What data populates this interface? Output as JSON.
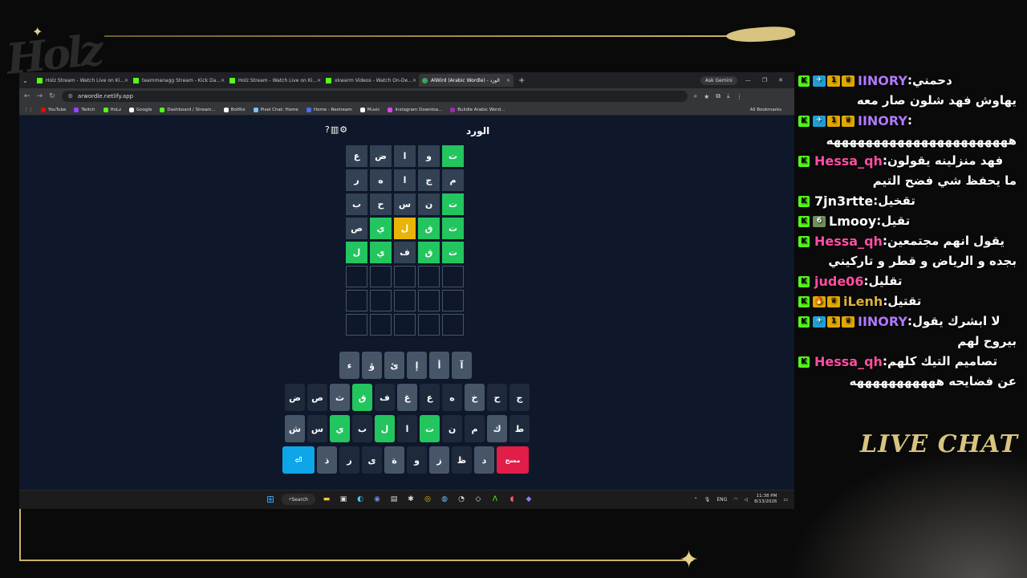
{
  "overlay": {
    "logo": "Holz",
    "live_chat_label": "LIVE CHAT"
  },
  "browser": {
    "tabs": [
      {
        "title": "Holz Stream - Watch Live on Ki..."
      },
      {
        "title": "teammanagg Stream - Kick Da..."
      },
      {
        "title": "Holz Stream - Watch Live on Ki..."
      },
      {
        "title": "xkwarm Videos - Watch On-De..."
      },
      {
        "title": "AlWird (Arabic Wordle) - الورد"
      }
    ],
    "ask_button": "Ask Gemini",
    "url": "arwordle.netlify.app",
    "bookmarks": [
      {
        "label": "YouTube",
        "color": "#ff0000"
      },
      {
        "label": "Twitch",
        "color": "#9146ff"
      },
      {
        "label": "HoLz",
        "color": "#53fc18"
      },
      {
        "label": "Google",
        "color": "#ffffff"
      },
      {
        "label": "Dashboard / Stream...",
        "color": "#53fc18"
      },
      {
        "label": "BotRix",
        "color": "#ffffff"
      },
      {
        "label": "Pixel Chat: Home",
        "color": "#7cc4ff"
      },
      {
        "label": "Home - Restream",
        "color": "#4b6bff"
      },
      {
        "label": "Music",
        "color": "#ffffff"
      },
      {
        "label": "Instagram Downloa...",
        "color": "#e040fb"
      },
      {
        "label": "Buildle Arabic Word...",
        "color": "#9c27b0"
      }
    ],
    "all_bookmarks": "All Bookmarks"
  },
  "game": {
    "title": "الورد",
    "icons": [
      "help-icon",
      "stats-icon",
      "settings-icon"
    ],
    "rows": [
      [
        {
          "l": "ت",
          "s": "correct"
        },
        {
          "l": "و",
          "s": "absent"
        },
        {
          "l": "ا",
          "s": "absent"
        },
        {
          "l": "ض",
          "s": "absent"
        },
        {
          "l": "ع",
          "s": "absent"
        }
      ],
      [
        {
          "l": "م",
          "s": "absent"
        },
        {
          "l": "ج",
          "s": "absent"
        },
        {
          "l": "ا",
          "s": "absent"
        },
        {
          "l": "ه",
          "s": "absent"
        },
        {
          "l": "ر",
          "s": "absent"
        }
      ],
      [
        {
          "l": "ت",
          "s": "correct"
        },
        {
          "l": "ن",
          "s": "absent"
        },
        {
          "l": "س",
          "s": "absent"
        },
        {
          "l": "ح",
          "s": "absent"
        },
        {
          "l": "ب",
          "s": "absent"
        }
      ],
      [
        {
          "l": "ت",
          "s": "correct"
        },
        {
          "l": "ق",
          "s": "correct"
        },
        {
          "l": "ل",
          "s": "present"
        },
        {
          "l": "ي",
          "s": "correct"
        },
        {
          "l": "ص",
          "s": "absent"
        }
      ],
      [
        {
          "l": "ت",
          "s": "correct"
        },
        {
          "l": "ق",
          "s": "correct"
        },
        {
          "l": "ف",
          "s": "absent"
        },
        {
          "l": "ي",
          "s": "correct"
        },
        {
          "l": "ل",
          "s": "correct"
        }
      ],
      [
        {
          "l": "",
          "s": "empty"
        },
        {
          "l": "",
          "s": "empty"
        },
        {
          "l": "",
          "s": "empty"
        },
        {
          "l": "",
          "s": "empty"
        },
        {
          "l": "",
          "s": "empty"
        }
      ],
      [
        {
          "l": "",
          "s": "empty"
        },
        {
          "l": "",
          "s": "empty"
        },
        {
          "l": "",
          "s": "empty"
        },
        {
          "l": "",
          "s": "empty"
        },
        {
          "l": "",
          "s": "empty"
        }
      ],
      [
        {
          "l": "",
          "s": "empty"
        },
        {
          "l": "",
          "s": "empty"
        },
        {
          "l": "",
          "s": "empty"
        },
        {
          "l": "",
          "s": "empty"
        },
        {
          "l": "",
          "s": "empty"
        }
      ]
    ],
    "keyboard": [
      [
        {
          "k": "آ",
          "s": "used"
        },
        {
          "k": "أ",
          "s": "used"
        },
        {
          "k": "إ",
          "s": "used"
        },
        {
          "k": "ئ",
          "s": "used"
        },
        {
          "k": "ؤ",
          "s": "used"
        },
        {
          "k": "ء",
          "s": "used"
        }
      ],
      [
        {
          "k": "ج",
          "s": "dark"
        },
        {
          "k": "ح",
          "s": "dark"
        },
        {
          "k": "خ",
          "s": "used"
        },
        {
          "k": "ه",
          "s": "dark"
        },
        {
          "k": "ع",
          "s": "dark"
        },
        {
          "k": "غ",
          "s": "used"
        },
        {
          "k": "ف",
          "s": "dark"
        },
        {
          "k": "ق",
          "s": "correct"
        },
        {
          "k": "ث",
          "s": "used"
        },
        {
          "k": "ص",
          "s": "dark"
        },
        {
          "k": "ض",
          "s": "dark"
        }
      ],
      [
        {
          "k": "ط",
          "s": "dark"
        },
        {
          "k": "ك",
          "s": "used"
        },
        {
          "k": "م",
          "s": "dark"
        },
        {
          "k": "ن",
          "s": "dark"
        },
        {
          "k": "ت",
          "s": "correct"
        },
        {
          "k": "ا",
          "s": "dark"
        },
        {
          "k": "ل",
          "s": "correct"
        },
        {
          "k": "ب",
          "s": "dark"
        },
        {
          "k": "ي",
          "s": "correct"
        },
        {
          "k": "س",
          "s": "dark"
        },
        {
          "k": "ش",
          "s": "used"
        }
      ],
      [
        {
          "k": "مسح",
          "s": "del"
        },
        {
          "k": "د",
          "s": "used"
        },
        {
          "k": "ظ",
          "s": "dark"
        },
        {
          "k": "ز",
          "s": "used"
        },
        {
          "k": "و",
          "s": "dark"
        },
        {
          "k": "ة",
          "s": "used"
        },
        {
          "k": "ى",
          "s": "dark"
        },
        {
          "k": "ر",
          "s": "dark"
        },
        {
          "k": "ذ",
          "s": "used"
        },
        {
          "k": "⏎",
          "s": "enter"
        }
      ]
    ]
  },
  "taskbar": {
    "search_label": "Search",
    "lang": "ENG",
    "time": "11:38 PM",
    "date": "8/13/2026"
  },
  "chat": [
    {
      "user": "IINORY",
      "color": "#b179ff",
      "badges": [
        "sub",
        "1",
        "crown"
      ],
      "text": "دحمني",
      "cont": "يهاوش فهد شلون صار معه"
    },
    {
      "user": "IINORY",
      "color": "#b179ff",
      "badges": [
        "sub",
        "1",
        "crown"
      ],
      "text": "",
      "cont": "هههههههههههههههههههههههه"
    },
    {
      "user": "Hessa_qh",
      "color": "#ff4fa3",
      "badges": [],
      "text": "فهد منزلينه يقولون",
      "cont": "ما يحفظ شي فضح التيم"
    },
    {
      "user": "7jn3rtte",
      "color": "#ffffff",
      "badges": [],
      "text": "تقخيل",
      "cont": ""
    },
    {
      "user": "Lmooy",
      "color": "#ffffff",
      "badges": [
        "green"
      ],
      "text": "تقيل",
      "cont": ""
    },
    {
      "user": "Hessa_qh",
      "color": "#ff4fa3",
      "badges": [],
      "text": "يقول انهم مجتمعين",
      "cont": "بجده و الرياض و قطر و تاركيني"
    },
    {
      "user": "jude06",
      "color": "#ff4fa3",
      "badges": [],
      "text": "تقليل",
      "cont": ""
    },
    {
      "user": "iLenh",
      "color": "#e0b13a",
      "badges": [
        "fire",
        "crown"
      ],
      "text": "تقتيل",
      "cont": ""
    },
    {
      "user": "IINORY",
      "color": "#b179ff",
      "badges": [
        "sub",
        "1",
        "crown"
      ],
      "text": "لا ابشرك يقول",
      "cont": "بيروح لهم"
    },
    {
      "user": "Hessa_qh",
      "color": "#ff4fa3",
      "badges": [],
      "text": "تصاميم التيك كلهم",
      "cont": "عن فضايحه هههههههههههه"
    }
  ]
}
